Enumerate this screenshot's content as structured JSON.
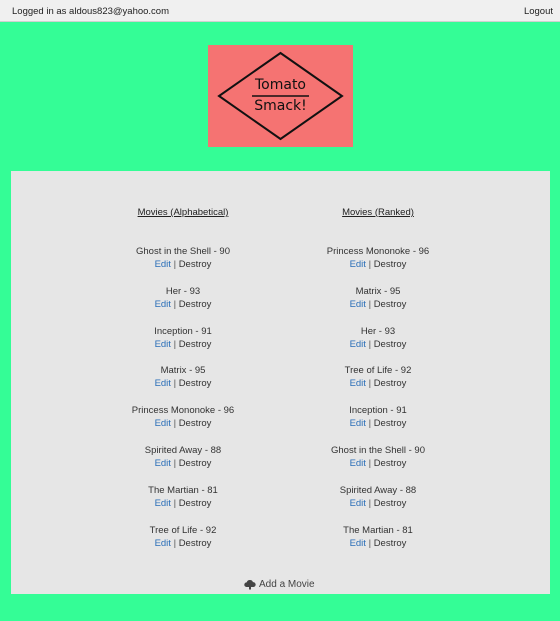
{
  "topbar": {
    "logged_in_text": "Logged in as aldous823@yahoo.com",
    "logout_label": "Logout"
  },
  "logo": {
    "line1": "Tomato",
    "line2": "Smack!",
    "background_color": "#f57372"
  },
  "page": {
    "background_color": "#34fd96",
    "panel_color": "#e6e6e6",
    "link_color": "#2a6eb8"
  },
  "alphabetical": {
    "title": "Movies (Alphabetical)",
    "movies": [
      {
        "title": "Ghost in the Shell - 90",
        "edit": "Edit",
        "sep": "|",
        "destroy": "Destroy"
      },
      {
        "title": "Her - 93",
        "edit": "Edit",
        "sep": "|",
        "destroy": "Destroy"
      },
      {
        "title": "Inception - 91",
        "edit": "Edit",
        "sep": "|",
        "destroy": "Destroy"
      },
      {
        "title": "Matrix - 95",
        "edit": "Edit",
        "sep": "|",
        "destroy": "Destroy"
      },
      {
        "title": "Princess Mononoke - 96",
        "edit": "Edit",
        "sep": "|",
        "destroy": "Destroy"
      },
      {
        "title": "Spirited Away - 88",
        "edit": "Edit",
        "sep": "|",
        "destroy": "Destroy"
      },
      {
        "title": "The Martian - 81",
        "edit": "Edit",
        "sep": "|",
        "destroy": "Destroy"
      },
      {
        "title": "Tree of Life - 92",
        "edit": "Edit",
        "sep": "|",
        "destroy": "Destroy"
      }
    ]
  },
  "ranked": {
    "title": "Movies (Ranked)",
    "movies": [
      {
        "title": "Princess Mononoke - 96",
        "edit": "Edit",
        "sep": "|",
        "destroy": "Destroy"
      },
      {
        "title": "Matrix - 95",
        "edit": "Edit",
        "sep": "|",
        "destroy": "Destroy"
      },
      {
        "title": "Her - 93",
        "edit": "Edit",
        "sep": "|",
        "destroy": "Destroy"
      },
      {
        "title": "Tree of Life - 92",
        "edit": "Edit",
        "sep": "|",
        "destroy": "Destroy"
      },
      {
        "title": "Inception - 91",
        "edit": "Edit",
        "sep": "|",
        "destroy": "Destroy"
      },
      {
        "title": "Ghost in the Shell - 90",
        "edit": "Edit",
        "sep": "|",
        "destroy": "Destroy"
      },
      {
        "title": "Spirited Away - 88",
        "edit": "Edit",
        "sep": "|",
        "destroy": "Destroy"
      },
      {
        "title": "The Martian - 81",
        "edit": "Edit",
        "sep": "|",
        "destroy": "Destroy"
      }
    ]
  },
  "add_movie": {
    "label": "Add a Movie",
    "icon": "cloud-upload-icon"
  }
}
